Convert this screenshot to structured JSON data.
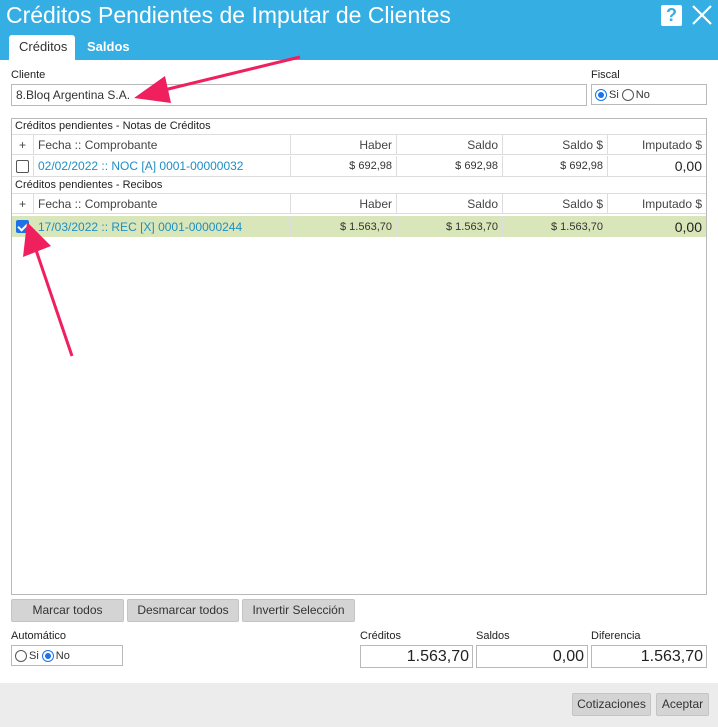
{
  "window": {
    "title": "Créditos Pendientes de Imputar de Clientes",
    "help_label": "?",
    "accent_color": "#35aee4"
  },
  "tabs": [
    {
      "label": "Créditos",
      "active": true
    },
    {
      "label": "Saldos",
      "active": false
    }
  ],
  "cliente": {
    "label": "Cliente",
    "value": "8.Bloq Argentina S.A."
  },
  "fiscal": {
    "label": "Fiscal",
    "options": [
      "Si",
      "No"
    ],
    "selected": "Si"
  },
  "notas_credito": {
    "section_title": "Créditos pendientes - Notas de Créditos",
    "headers": [
      "+",
      "Fecha :: Comprobante",
      "Haber",
      "Saldo",
      "Saldo $",
      "Imputado $"
    ],
    "rows": [
      {
        "checked": false,
        "comprobante": "02/02/2022 :: NOC [A] 0001-00000032",
        "haber": "$ 692,98",
        "saldo": "$ 692,98",
        "saldo_pesos": "$ 692,98",
        "imputado": "0,00"
      }
    ]
  },
  "recibos": {
    "section_title": "Créditos pendientes - Recibos",
    "headers": [
      "+",
      "Fecha :: Comprobante",
      "Haber",
      "Saldo",
      "Saldo $",
      "Imputado $"
    ],
    "rows": [
      {
        "checked": true,
        "comprobante": "17/03/2022 :: REC [X] 0001-00000244",
        "haber": "$ 1.563,70",
        "saldo": "$ 1.563,70",
        "saldo_pesos": "$ 1.563,70",
        "imputado": "0,00"
      }
    ]
  },
  "actions": {
    "marcar": "Marcar todos",
    "desmarcar": "Desmarcar todos",
    "invertir": "Invertir Selección"
  },
  "automatico": {
    "label": "Automático",
    "options": [
      "Si",
      "No"
    ],
    "selected": "No"
  },
  "totals": {
    "creditos_label": "Créditos",
    "creditos_value": "1.563,70",
    "saldos_label": "Saldos",
    "saldos_value": "0,00",
    "diferencia_label": "Diferencia",
    "diferencia_value": "1.563,70"
  },
  "footer": {
    "cotizaciones": "Cotizaciones",
    "aceptar": "Aceptar"
  },
  "annotation_color": "#f0205f"
}
